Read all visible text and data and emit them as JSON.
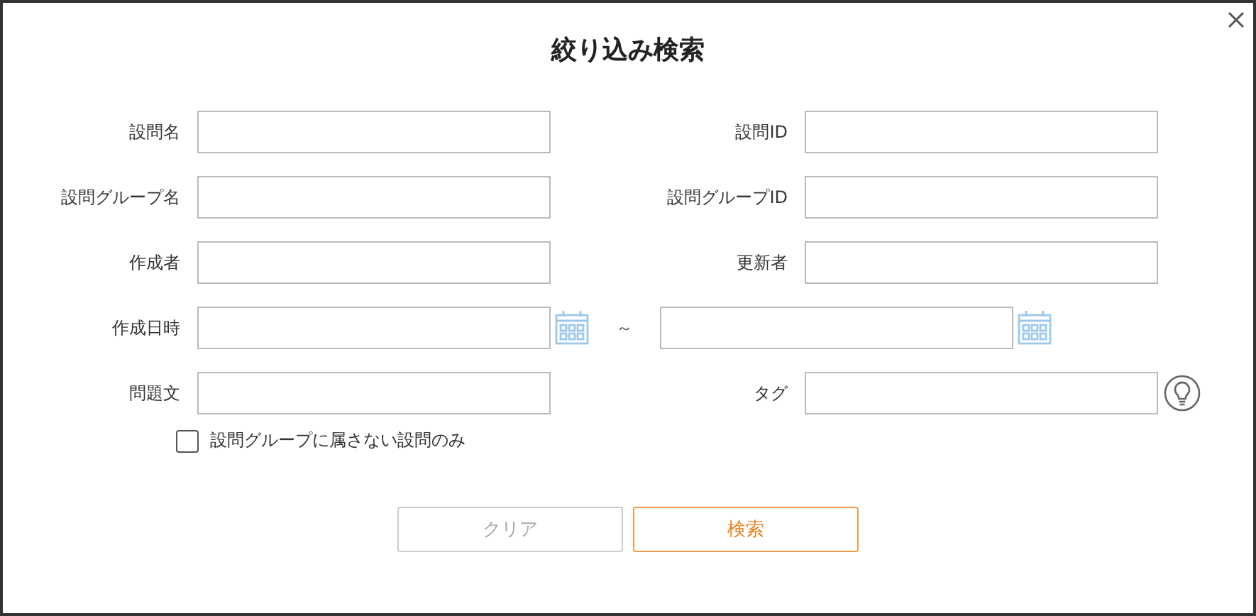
{
  "dialog": {
    "title": "絞り込み検索"
  },
  "rows": [
    {
      "kind": "pair",
      "left": {
        "label": "設問名"
      },
      "right": {
        "label": "設問ID"
      }
    },
    {
      "kind": "pair",
      "left": {
        "label": "設問グループ名"
      },
      "right": {
        "label": "設問グループID"
      }
    },
    {
      "kind": "pair",
      "left": {
        "label": "作成者"
      },
      "right": {
        "label": "更新者"
      }
    },
    {
      "kind": "range",
      "left": {
        "label": "作成日時"
      },
      "separator": "～"
    },
    {
      "kind": "pair",
      "left": {
        "label": "問題文"
      },
      "right": {
        "label": "タグ",
        "hint_icon": true
      }
    }
  ],
  "checkbox": {
    "label": "設問グループに属さない設問のみ",
    "checked": false
  },
  "buttons": [
    {
      "label": "クリア",
      "kind": "secondary",
      "disabled": true
    },
    {
      "label": "検索",
      "kind": "primary",
      "disabled": false
    }
  ]
}
